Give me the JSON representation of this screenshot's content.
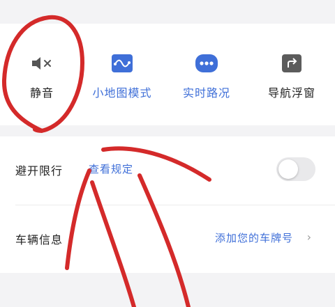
{
  "toolbar": {
    "items": [
      {
        "label": "静音",
        "icon": "mute-speaker-icon"
      },
      {
        "label": "小地图模式",
        "icon": "mini-map-icon"
      },
      {
        "label": "实时路况",
        "icon": "traffic-dots-icon"
      },
      {
        "label": "导航浮窗",
        "icon": "floating-window-icon"
      }
    ]
  },
  "restriction": {
    "title": "避开限行",
    "link": "查看规定",
    "toggle_on": false
  },
  "vehicle": {
    "title": "车辆信息",
    "value": "添加您的车牌号",
    "chevron": "›"
  },
  "colors": {
    "accent": "#3f6fd8",
    "icon_gray": "#555555",
    "annotation": "#d42a2a"
  }
}
